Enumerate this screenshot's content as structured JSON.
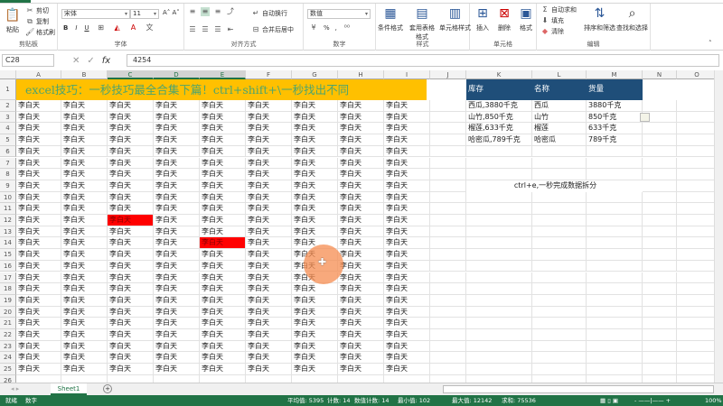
{
  "ribbon": {
    "clipboard": {
      "paste": "粘贴",
      "cut": "剪切",
      "copy": "复制",
      "format_painter": "格式刷",
      "label": "剪贴板"
    },
    "font": {
      "name": "宋体",
      "size": "11",
      "bold": "B",
      "italic": "I",
      "underline": "U",
      "label": "字体"
    },
    "alignment": {
      "wrap": "自动换行",
      "merge": "合并后居中",
      "label": "对齐方式"
    },
    "number": {
      "format": "数值",
      "percent": "%",
      "comma": ",",
      "label": "数字"
    },
    "styles": {
      "conditional": "条件格式",
      "table": "套用表格格式",
      "cell": "单元格样式",
      "label": "样式"
    },
    "cells": {
      "insert": "插入",
      "delete": "删除",
      "format": "格式",
      "label": "单元格"
    },
    "editing": {
      "autosum": "自动求和",
      "fill": "填充",
      "clear": "清除",
      "sort": "排序和筛选",
      "find": "查找和选择",
      "label": "编辑"
    }
  },
  "formula_bar": {
    "name_box": "C28",
    "fx": "fx",
    "value": "4254"
  },
  "columns": [
    "A",
    "B",
    "C",
    "D",
    "E",
    "F",
    "G",
    "H",
    "I",
    "J",
    "K",
    "L",
    "M",
    "N",
    "O"
  ],
  "selected_columns": [
    "C",
    "D",
    "E"
  ],
  "title_cell": "excel技巧：一秒技巧最全合集下篇！ctrl+shift+\\一秒找出不同",
  "grid": {
    "cell_text": "李白天",
    "first_row": 2,
    "last_row": 25,
    "visible_rows": 26,
    "highlighted": [
      {
        "col": "C",
        "row": 12
      },
      {
        "col": "E",
        "row": 14
      }
    ],
    "highlight_color": "#ff0000"
  },
  "table": {
    "headers": [
      "库存",
      "名称",
      "货量"
    ],
    "rows": [
      [
        "西瓜,3880千克",
        "西瓜",
        "3880千克"
      ],
      [
        "山竹,850千克",
        "山竹",
        "850千克"
      ],
      [
        "榴莲,633千克",
        "榴莲",
        "633千克"
      ],
      [
        "哈密瓜,789千克",
        "哈密瓜",
        "789千克"
      ]
    ],
    "note": "ctrl+e,一秒完成数据拆分"
  },
  "sheet_tabs": {
    "active": "Sheet1",
    "add": "+"
  },
  "status": {
    "ready": "就绪",
    "mode": "数字",
    "average": "平均值: 5395",
    "count": "计数: 14",
    "num_count": "数值计数: 14",
    "min": "最小值: 102",
    "max": "最大值: 12142",
    "sum": "求和: 75536",
    "zoom": "100%"
  }
}
